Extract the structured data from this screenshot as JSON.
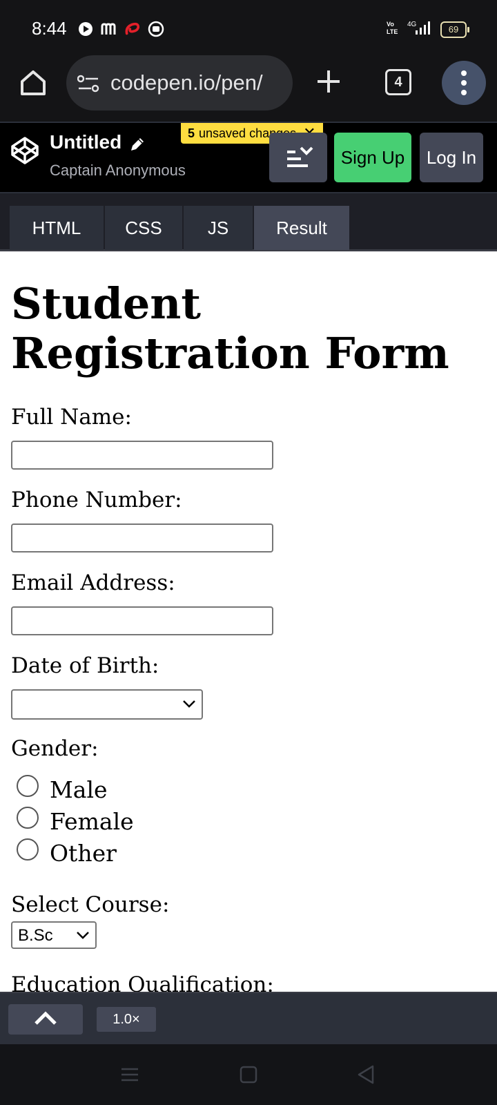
{
  "status_bar": {
    "time": "8:44",
    "battery": "69",
    "network": "4G"
  },
  "browser": {
    "url": "codepen.io/pen/",
    "tab_count": "4"
  },
  "codepen": {
    "title": "Untitled",
    "author": "Captain Anonymous",
    "unsaved_count": "5",
    "unsaved_text": "unsaved changes",
    "signup_label": "Sign Up",
    "login_label": "Log In",
    "tabs": [
      {
        "label": "HTML",
        "active": false
      },
      {
        "label": "CSS",
        "active": false
      },
      {
        "label": "JS",
        "active": false
      },
      {
        "label": "Result",
        "active": true
      }
    ],
    "zoom": "1.0×"
  },
  "form": {
    "heading": "Student Registration Form",
    "full_name_label": "Full Name:",
    "phone_label": "Phone Number:",
    "email_label": "Email Address:",
    "dob_label": "Date of Birth:",
    "gender_label": "Gender:",
    "gender_options": [
      "Male",
      "Female",
      "Other"
    ],
    "course_label": "Select Course:",
    "course_value": "B.Sc",
    "education_label": "Education Qualification:"
  },
  "colors": {
    "signup_green": "#47cf73",
    "unsaved_yellow": "#ffdd40",
    "header_bg": "#000000",
    "tab_bg": "#2c303a",
    "tab_active_bg": "#444857"
  }
}
